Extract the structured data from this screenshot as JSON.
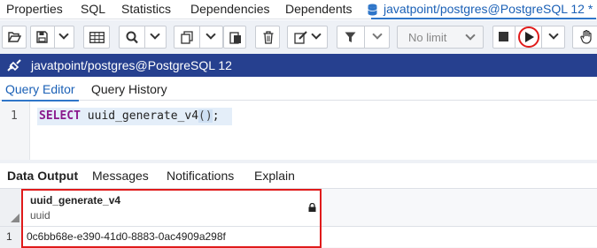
{
  "top_tabs": {
    "properties": "Properties",
    "sql": "SQL",
    "statistics": "Statistics",
    "dependencies": "Dependencies",
    "dependents": "Dependents",
    "query_tool": "javatpoint/postgres@PostgreSQL 12 *"
  },
  "toolbar": {
    "limit_selected": "No limit",
    "icons": [
      "open-folder-icon",
      "save-icon",
      "chevron-down-icon",
      "table-icon",
      "search-icon",
      "chevron-down-icon",
      "copy-icon",
      "chevron-down-icon",
      "paste-icon",
      "delete-icon",
      "edit-icon",
      "chevron-down-icon",
      "filter-icon",
      "chevron-down-icon",
      "stop-icon",
      "execute-icon",
      "chevron-down-icon",
      "hand-icon"
    ],
    "accent_color": "#26408f",
    "highlight_color": "#e01b1b"
  },
  "connection": {
    "title": "javatpoint/postgres@PostgreSQL 12"
  },
  "editor_tabs": {
    "query_editor": "Query Editor",
    "query_history": "Query History"
  },
  "editor": {
    "line_number": "1",
    "keyword": "SELECT",
    "function": "uuid_generate_v4",
    "parens": "()",
    "terminator": ";"
  },
  "output_tabs": {
    "data_output": "Data Output",
    "messages": "Messages",
    "notifications": "Notifications",
    "explain": "Explain"
  },
  "result_grid": {
    "columns": [
      {
        "name": "uuid_generate_v4",
        "type": "uuid"
      }
    ],
    "rows": [
      {
        "row_number": "1",
        "values": [
          "0c6bb68e-e390-41d0-8883-0ac4909a298f"
        ]
      }
    ]
  }
}
